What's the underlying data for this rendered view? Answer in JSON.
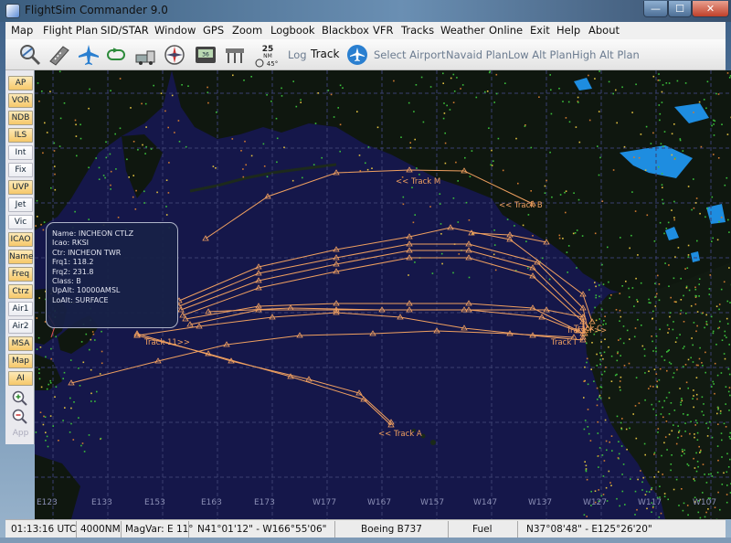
{
  "window": {
    "title": "FlightSim Commander 9.0",
    "min_glyph": "—",
    "max_glyph": "☐",
    "close_glyph": "✕"
  },
  "menu": [
    "Map",
    "Flight Plan",
    "SID/STAR",
    "Window",
    "GPS",
    "Zoom",
    "Logbook",
    "Blackbox",
    "VFR",
    "Tracks",
    "Weather",
    "Online",
    "Exit",
    "Help",
    "About"
  ],
  "toolbar": {
    "icons": [
      "zoom-map-icon",
      "runway-icon",
      "airplane-icon",
      "holding-pattern-icon",
      "route-vehicle-icon",
      "compass-icon",
      "gps-unit-icon",
      "ils-antenna-icon",
      "range-wind-icon"
    ],
    "range_value": "25",
    "range_unit": "NM",
    "range_angle": "45°",
    "gps_label": "36",
    "log": "Log",
    "track": "Track",
    "select_airport": "Select Airport",
    "navaid_plan": "Navaid Plan",
    "low_alt_plan": "Low Alt Plan",
    "high_alt_plan": "High Alt Plan"
  },
  "sidebar": {
    "buttons": [
      {
        "label": "AP",
        "style": "orange"
      },
      {
        "label": "VOR",
        "style": "orange"
      },
      {
        "label": "NDB",
        "style": "orange"
      },
      {
        "label": "ILS",
        "style": "orange"
      },
      {
        "label": "Int",
        "style": "white"
      },
      {
        "label": "Fix",
        "style": "white"
      },
      {
        "label": "UVP",
        "style": "orange"
      },
      {
        "label": "Jet",
        "style": "white"
      },
      {
        "label": "Vic",
        "style": "white"
      },
      {
        "label": "ICAO",
        "style": "orange"
      },
      {
        "label": "Name",
        "style": "orange"
      },
      {
        "label": "Freq",
        "style": "orange"
      },
      {
        "label": "Ctrz",
        "style": "orange"
      },
      {
        "label": "Air1",
        "style": "white"
      },
      {
        "label": "Air2",
        "style": "white"
      },
      {
        "label": "MSA",
        "style": "orange"
      },
      {
        "label": "Map",
        "style": "orange"
      },
      {
        "label": "AI",
        "style": "orange"
      }
    ],
    "zoom_in": "zoom-in-icon",
    "zoom_out": "zoom-out-icon",
    "app": "App"
  },
  "map": {
    "longitude_labels": [
      "E123",
      "E133",
      "E153",
      "E163",
      "E173",
      "W177",
      "W167",
      "W157",
      "W147",
      "W137",
      "W127",
      "W117",
      "W107"
    ],
    "track_labels": [
      "<< Track M",
      "<< Track B",
      "Track F>>",
      "Track 11>>",
      "Track C",
      "Track I",
      "<< Track A"
    ],
    "info": {
      "name": "Name: INCHEON CTLZ",
      "icao": "Icao: RKSI",
      "ctr": "Ctr: INCHEON TWR",
      "frq1": "Frq1: 118.2",
      "frq2": "Frq2: 231.8",
      "class": "Class: B",
      "upalt": "UpAlt: 10000AMSL",
      "loalt": "LoAlt: SURFACE"
    },
    "colors": {
      "ocean": "#15174a",
      "land": "#101a10",
      "track": "#f0a060",
      "lake": "#1e8de0"
    }
  },
  "status": {
    "time": "01:13:16 UTC",
    "range": "4000NM",
    "magvar": "MagVar: E 11°",
    "position": "N41°01'12\" - W166°55'06\"",
    "aircraft": "Boeing B737",
    "fuel": "Fuel",
    "cursor": "N37°08'48\" - E125°26'20\""
  }
}
